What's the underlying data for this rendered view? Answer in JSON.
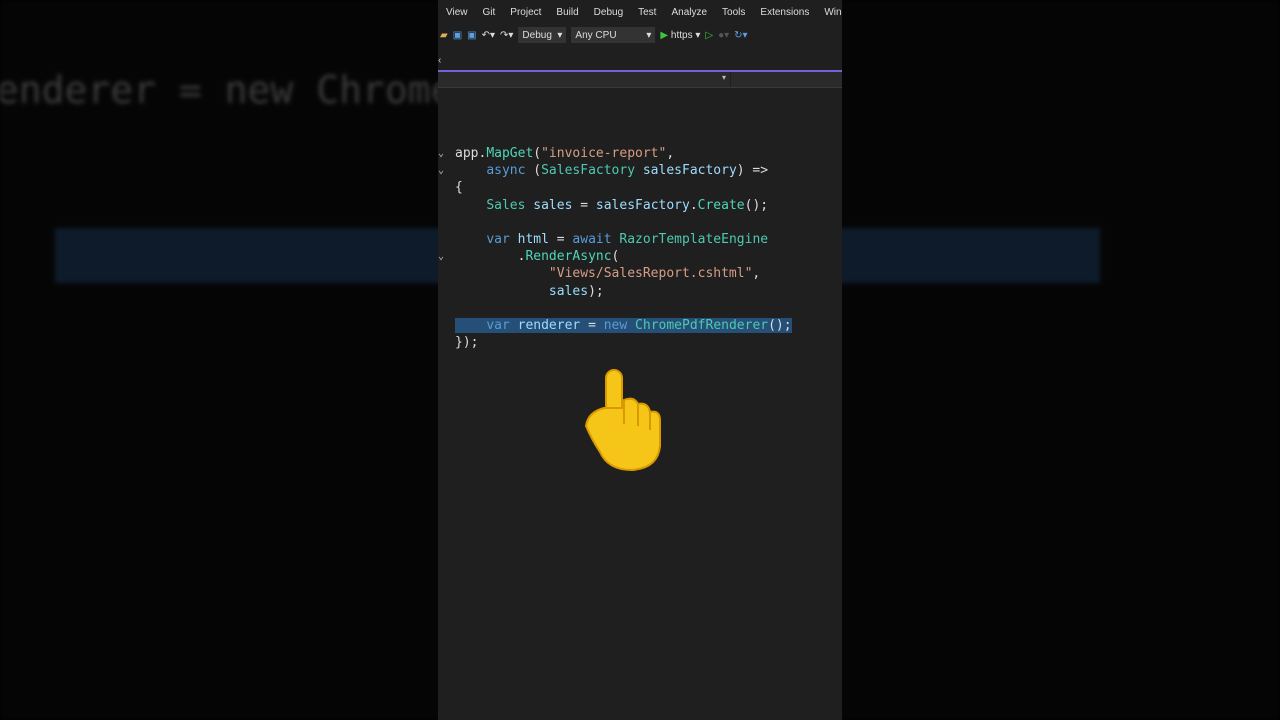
{
  "menu": [
    "View",
    "Git",
    "Project",
    "Build",
    "Debug",
    "Test",
    "Analyze",
    "Tools",
    "Extensions",
    "Window"
  ],
  "toolbar": {
    "config": "Debug",
    "platform": "Any CPU",
    "run_label": "https"
  },
  "code": [
    {
      "fold": true,
      "tokens": [
        [
          "p",
          "app."
        ],
        [
          "m",
          "MapGet"
        ],
        [
          "p",
          "("
        ],
        [
          "s",
          "\"invoice-report\""
        ],
        [
          "p",
          ","
        ]
      ]
    },
    {
      "fold": true,
      "tokens": [
        [
          "p",
          "    "
        ],
        [
          "k",
          "async"
        ],
        [
          "p",
          " ("
        ],
        [
          "t",
          "SalesFactory"
        ],
        [
          "p",
          " "
        ],
        [
          "v",
          "salesFactory"
        ],
        [
          "p",
          ") =>"
        ]
      ]
    },
    {
      "tokens": [
        [
          "p",
          "{"
        ]
      ]
    },
    {
      "tokens": [
        [
          "p",
          "    "
        ],
        [
          "t",
          "Sales"
        ],
        [
          "p",
          " "
        ],
        [
          "v",
          "sales"
        ],
        [
          "p",
          " = "
        ],
        [
          "v",
          "salesFactory"
        ],
        [
          "p",
          "."
        ],
        [
          "m",
          "Create"
        ],
        [
          "p",
          "();"
        ]
      ]
    },
    {
      "tokens": [
        [
          "p",
          ""
        ]
      ]
    },
    {
      "tokens": [
        [
          "p",
          "    "
        ],
        [
          "k",
          "var"
        ],
        [
          "p",
          " "
        ],
        [
          "v",
          "html"
        ],
        [
          "p",
          " = "
        ],
        [
          "k",
          "await"
        ],
        [
          "p",
          " "
        ],
        [
          "t",
          "RazorTemplateEngine"
        ]
      ]
    },
    {
      "fold": true,
      "tokens": [
        [
          "p",
          "        ."
        ],
        [
          "m",
          "RenderAsync"
        ],
        [
          "p",
          "("
        ]
      ]
    },
    {
      "tokens": [
        [
          "p",
          "            "
        ],
        [
          "s",
          "\"Views/SalesReport.cshtml\""
        ],
        [
          "p",
          ","
        ]
      ]
    },
    {
      "tokens": [
        [
          "p",
          "            "
        ],
        [
          "v",
          "sales"
        ],
        [
          "p",
          ");"
        ]
      ]
    },
    {
      "tokens": [
        [
          "p",
          ""
        ]
      ]
    },
    {
      "sel": true,
      "tokens": [
        [
          "p",
          "    "
        ],
        [
          "k",
          "var"
        ],
        [
          "p",
          " "
        ],
        [
          "v",
          "renderer"
        ],
        [
          "p",
          " = "
        ],
        [
          "k",
          "new"
        ],
        [
          "p",
          " "
        ],
        [
          "t",
          "ChromePdfRenderer"
        ],
        [
          "p",
          "();"
        ]
      ]
    },
    {
      "tokens": [
        [
          "p",
          "});"
        ]
      ]
    }
  ],
  "background_code": [
    "    .RenderAsync(",
    "        \"Views/SalesReport.cshtml\",",
    "        sales);",
    "",
    "    var renderer = new ChromePdfRenderer();",
    "});"
  ]
}
